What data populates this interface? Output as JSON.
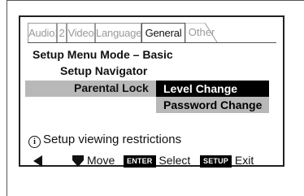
{
  "tabs": {
    "audio1": "Audio1",
    "audio2": "2",
    "video": "Video",
    "language": "Language",
    "general": "General",
    "other": "Other"
  },
  "menu": {
    "mode_label": "Setup Menu Mode – Basic",
    "navigator_label": "Setup Navigator",
    "parental_label": "Parental Lock",
    "options": [
      "Level Change",
      "Password Change"
    ]
  },
  "help": {
    "icon": "info-icon",
    "text": "Setup viewing restrictions"
  },
  "footer": {
    "left_arrow_icon": "arrow-left-icon",
    "move_icon": "arrow-down-icon",
    "move_label": "Move",
    "enter_key": "ENTER",
    "select_label": "Select",
    "setup_key": "SETUP",
    "exit_label": "Exit"
  },
  "colors": {
    "highlight": "#000000",
    "selected_row": "#b8b8b8"
  }
}
